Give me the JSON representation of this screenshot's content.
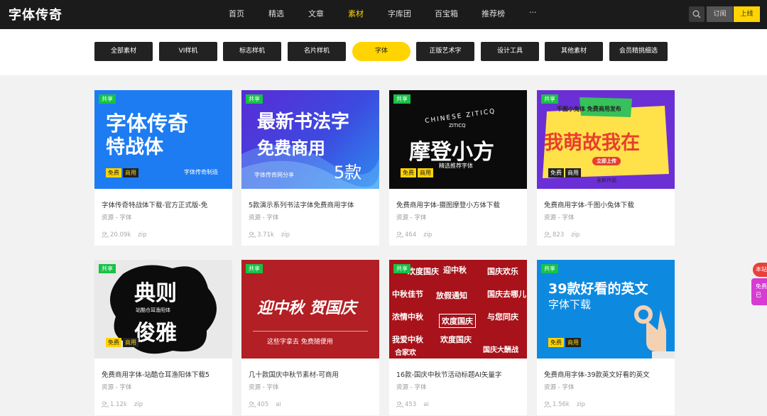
{
  "site": {
    "logo": "字体传奇",
    "nav": [
      "首页",
      "精选",
      "文章",
      "素材",
      "字库团",
      "百宝箱",
      "推荐榜",
      "···"
    ],
    "active_nav": "素材",
    "subscribe_label": "订阅",
    "online_label": "上线",
    "accent_color": "#ffd400"
  },
  "categories": [
    "全部素材",
    "VI样机",
    "标志样机",
    "名片样机",
    "字体",
    "正版艺术字",
    "设计工具",
    "其他素材",
    "会员精挑细选"
  ],
  "active_category": "字体",
  "cards": [
    {
      "badge": "共享",
      "thumb": {
        "line1": "字体传奇",
        "line2": "特战体",
        "tag1": "免费",
        "tag2": "商用",
        "credit": "字体传奇制造"
      },
      "title": "字体传奇特战体下载-官方正式版-免",
      "source": "资源 - 字体",
      "views": "20.09k",
      "ext": "zip"
    },
    {
      "badge": "共享",
      "thumb": {
        "line1": "最新书法字",
        "line2": "免费商用",
        "count": "5款",
        "credit": "字体传奇网分享"
      },
      "title": "5款演示系列书法字体免费商用字体",
      "source": "资源 - 字体",
      "views": "3.71k",
      "ext": "zip"
    },
    {
      "badge": "共享",
      "thumb": {
        "arc": "CHINESE ZITICQ",
        "small": "ZITICQ",
        "line1": "摩登小方",
        "tag1": "免费",
        "tag2": "商用",
        "credit": "精选推荐字体"
      },
      "title": "免费商用字体-摄图摩登小方体下载",
      "source": "资源 - 字体",
      "views": "464",
      "ext": "zip"
    },
    {
      "badge": "共享",
      "thumb": {
        "banner": "千图小兔体 免费商用发布",
        "line1": "我萌故我在",
        "pill": "立即上传",
        "tag1": "免费",
        "tag2": "商用",
        "credit": "全新作品"
      },
      "title": "免费商用字体-千图小兔体下载",
      "source": "资源 - 字体",
      "views": "823",
      "ext": "zip"
    },
    {
      "badge": "共享",
      "thumb": {
        "line1": "典则",
        "small": "站酷仓耳渔阳体",
        "line2": "俊雅",
        "tag1": "免费",
        "tag2": "商用"
      },
      "title": "免费商用字体-站酷仓耳渔阳体下载5",
      "source": "资源 - 字体",
      "views": "1.12k",
      "ext": "zip"
    },
    {
      "badge": "共享",
      "thumb": {
        "line1": "迎中秋 贺国庆",
        "line2": "这些字拿去 免费随便用"
      },
      "title": "几十款国庆中秋节素材-可商用",
      "source": "资源 - 字体",
      "views": "405",
      "ext": "ai"
    },
    {
      "badge": "共享",
      "thumb": {
        "words": [
          "欢度国庆",
          "迎中秋",
          "国庆欢乐",
          "中秋佳节",
          "放假通知",
          "国庆去哪儿",
          "浓情中秋",
          "欢度国庆",
          "与您同庆",
          "我爱中秋",
          "欢度国庆",
          "国庆大酬战",
          "合家欢"
        ]
      },
      "title": "16款-国庆中秋节活动标题AI矢量字",
      "source": "资源 - 字体",
      "views": "453",
      "ext": "ai"
    },
    {
      "badge": "共享",
      "thumb": {
        "line1": "39款好看的英文",
        "line2": "字体下载",
        "tag1": "免费",
        "tag2": "商用"
      },
      "title": "免费商用字体-39款英文好看的英文",
      "source": "资源 - 字体",
      "views": "1.56k",
      "ext": "zip"
    }
  ],
  "float": {
    "top": "本站",
    "bottom1": "免费",
    "bottom2": "已"
  }
}
